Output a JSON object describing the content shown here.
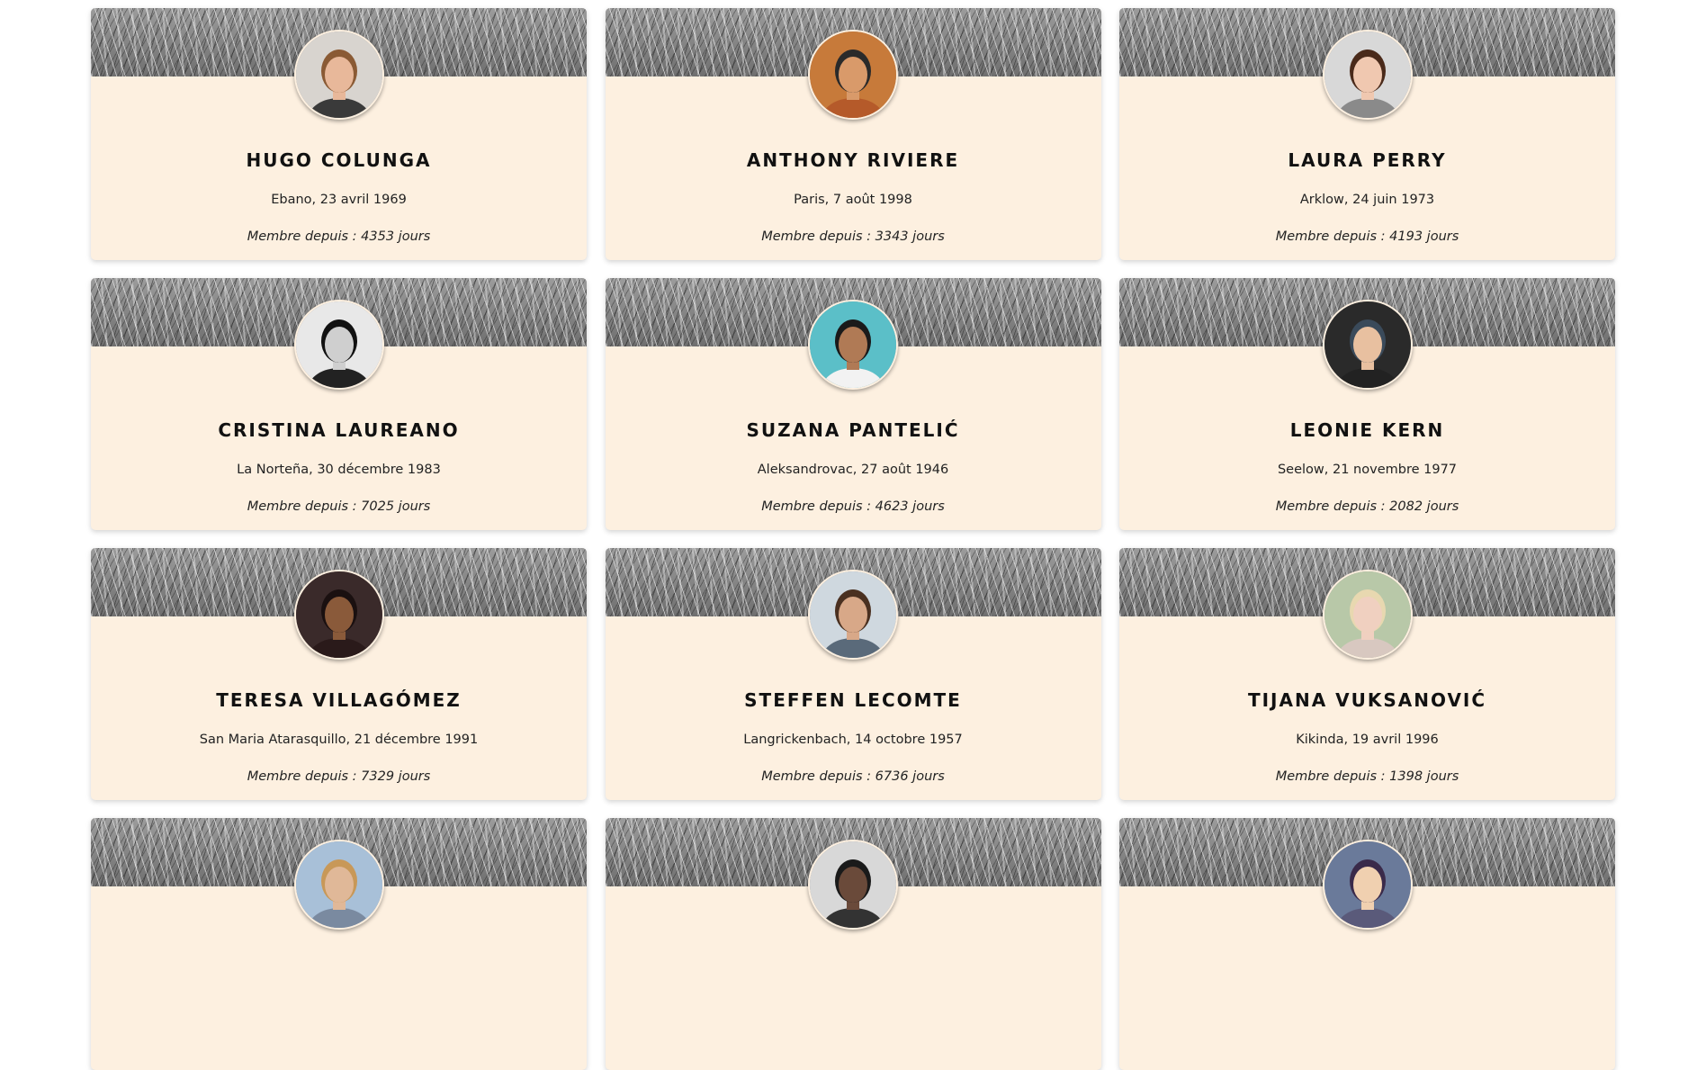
{
  "member_prefix": "Membre depuis : ",
  "member_suffix": " jours",
  "members": [
    {
      "name": "HUGO COLUNGA",
      "birth": "Ebano, 23 avril 1969",
      "days": "4353",
      "avatar": {
        "bg": "#d8d4cf",
        "skin": "#e8b89a",
        "hair": "#8a5a34",
        "shirt": "#3a3a3a"
      }
    },
    {
      "name": "ANTHONY RIVIERE",
      "birth": "Paris, 7 août 1998",
      "days": "3343",
      "avatar": {
        "bg": "#c77a3a",
        "skin": "#d99a6a",
        "hair": "#2a2a2a",
        "shirt": "#b55a2a"
      }
    },
    {
      "name": "LAURA PERRY",
      "birth": "Arklow, 24 juin 1973",
      "days": "4193",
      "avatar": {
        "bg": "#d8d8d8",
        "skin": "#f0c8b0",
        "hair": "#4a2a1a",
        "shirt": "#8a8a8a"
      }
    },
    {
      "name": "CRISTINA LAUREANO",
      "birth": "La Norteña, 30 décembre 1983",
      "days": "7025",
      "avatar": {
        "bg": "#e8e8e8",
        "skin": "#cfcfcf",
        "hair": "#111111",
        "shirt": "#222222"
      }
    },
    {
      "name": "SUZANA PANTELIĆ",
      "birth": "Aleksandrovac, 27 août 1946",
      "days": "4623",
      "avatar": {
        "bg": "#5bbfc8",
        "skin": "#b07a55",
        "hair": "#1a1a1a",
        "shirt": "#f2f2f2"
      }
    },
    {
      "name": "LEONIE KERN",
      "birth": "Seelow, 21 novembre 1977",
      "days": "2082",
      "avatar": {
        "bg": "#2a2a2a",
        "skin": "#e8c0a0",
        "hair": "#3a4a5a",
        "shirt": "#222222"
      }
    },
    {
      "name": "TERESA VILLAGÓMEZ",
      "birth": "San Maria Atarasquillo, 21 décembre 1991",
      "days": "7329",
      "avatar": {
        "bg": "#3a2a2a",
        "skin": "#8a5a3a",
        "hair": "#1a1010",
        "shirt": "#2a1a1a"
      }
    },
    {
      "name": "STEFFEN LECOMTE",
      "birth": "Langrickenbach, 14 octobre 1957",
      "days": "6736",
      "avatar": {
        "bg": "#cfd8df",
        "skin": "#d8a888",
        "hair": "#4a3020",
        "shirt": "#5a6a7a"
      }
    },
    {
      "name": "TIJANA VUKSANOVIĆ",
      "birth": "Kikinda, 19 avril 1996",
      "days": "1398",
      "avatar": {
        "bg": "#b8c8a8",
        "skin": "#f0d0c0",
        "hair": "#e8d8b0",
        "shirt": "#d8c8c0"
      }
    },
    {
      "name": "",
      "birth": "",
      "days": "",
      "avatar": {
        "bg": "#a8c0d8",
        "skin": "#e0b898",
        "hair": "#c89858",
        "shirt": "#7a8aa0"
      }
    },
    {
      "name": "",
      "birth": "",
      "days": "",
      "avatar": {
        "bg": "#d8d8d8",
        "skin": "#6a4a3a",
        "hair": "#1a1a1a",
        "shirt": "#333333"
      }
    },
    {
      "name": "",
      "birth": "",
      "days": "",
      "avatar": {
        "bg": "#6a7a9a",
        "skin": "#f0d0b0",
        "hair": "#3a2a4a",
        "shirt": "#5a5a7a"
      }
    }
  ]
}
